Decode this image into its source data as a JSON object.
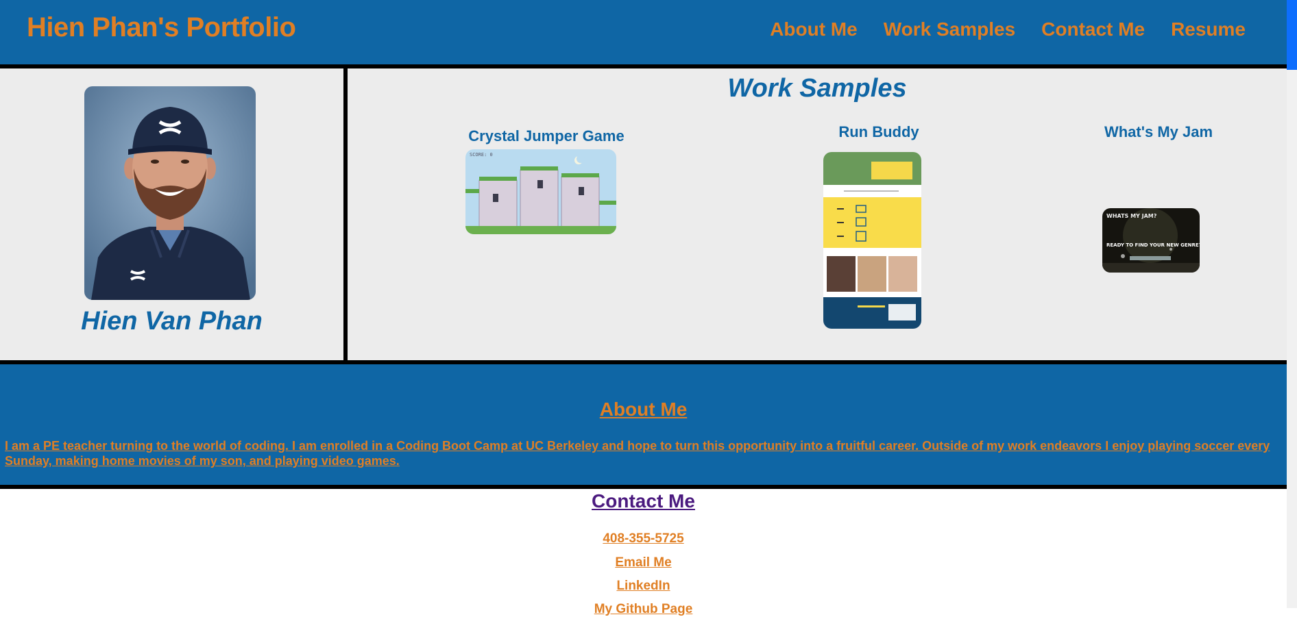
{
  "header": {
    "site_title": "Hien Phan's Portfolio",
    "nav": [
      "About Me",
      "Work Samples",
      "Contact Me",
      "Resume"
    ]
  },
  "profile": {
    "name": "Hien Van Phan"
  },
  "work_samples": {
    "title": "Work Samples",
    "items": [
      {
        "title": "Crystal Jumper Game",
        "thumb_text": "SCORE: 0"
      },
      {
        "title": "Run Buddy"
      },
      {
        "title": "What's My Jam",
        "thumb_text_1": "WHATS MY JAM?",
        "thumb_text_2": "READY TO FIND YOUR NEW GENRE?"
      }
    ]
  },
  "about": {
    "title": "About Me",
    "text": "I am a PE teacher turning to the world of coding. I am enrolled in a Coding Boot Camp at UC Berkeley and hope to turn this opportunity into a fruitful career. Outside of my work endeavors I enjoy playing soccer every Sunday, making home movies of my son, and playing video games."
  },
  "contact": {
    "title": "Contact Me",
    "phone": "408-355-5725",
    "email": "Email Me",
    "linkedin": "LinkedIn",
    "github": "My Github Page"
  },
  "colors": {
    "brand_blue": "#0f66a5",
    "accent_orange": "#e07f24",
    "visited_purple": "#4b1a7f",
    "hero_bg": "#ececec"
  }
}
